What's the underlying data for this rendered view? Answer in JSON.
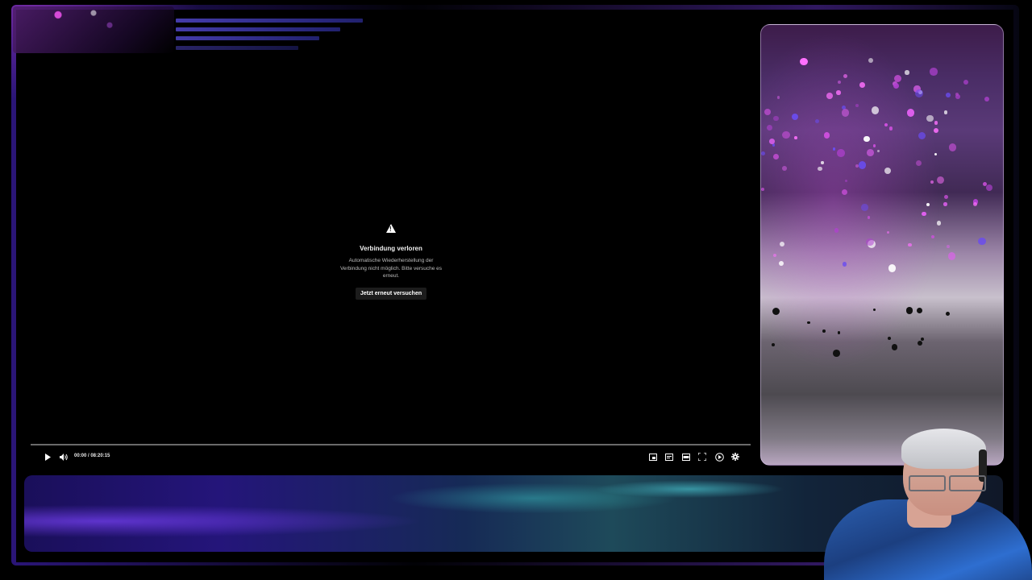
{
  "player": {
    "error": {
      "icon": "warning-icon",
      "title": "Verbindung verloren",
      "message": "Automatische Wiederherstellung der Verbindung nicht möglich. Bitte versuche es erneut.",
      "retry_label": "Jetzt erneut versuchen"
    },
    "time_display": "00:00 / 08:20:15",
    "progress_fraction": 0,
    "controls_left": [
      "play-icon",
      "volume-icon"
    ],
    "controls_right": [
      "miniplayer-icon",
      "captions-icon",
      "theater-mode-icon",
      "fullscreen-icon",
      "autoplay-icon",
      "settings-icon"
    ]
  },
  "decor": {
    "accent_colors": [
      "#5a3cd8",
      "#c84fe0",
      "#3cc8c8"
    ]
  }
}
